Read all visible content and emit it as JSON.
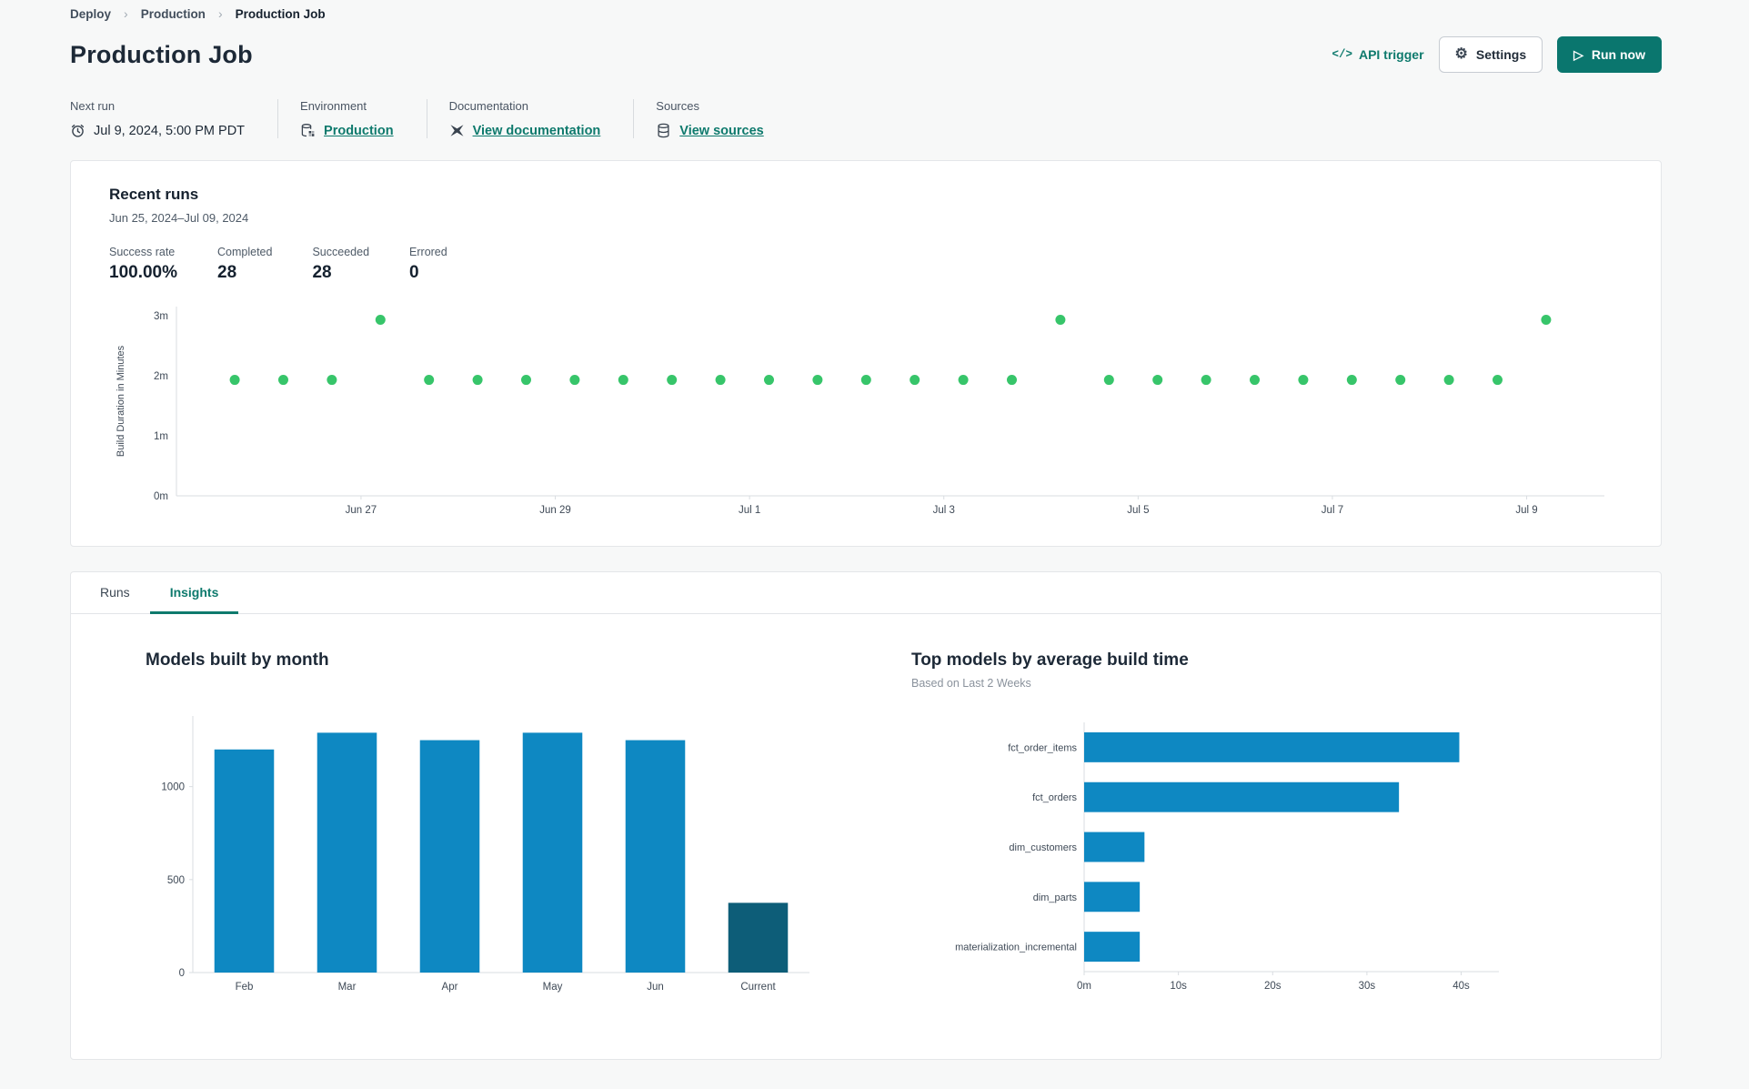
{
  "breadcrumb": {
    "items": [
      "Deploy",
      "Production",
      "Production Job"
    ]
  },
  "header": {
    "title": "Production Job",
    "api_trigger_label": "API trigger",
    "settings_label": "Settings",
    "run_now_label": "Run now"
  },
  "info": {
    "next_run": {
      "label": "Next run",
      "value": "Jul 9, 2024, 5:00 PM PDT"
    },
    "environment": {
      "label": "Environment",
      "value": "Production"
    },
    "documentation": {
      "label": "Documentation",
      "value": "View documentation"
    },
    "sources": {
      "label": "Sources",
      "value": "View sources"
    }
  },
  "recent_runs": {
    "title": "Recent runs",
    "date_range": "Jun 25, 2024–Jul 09, 2024",
    "stats": [
      {
        "label": "Success rate",
        "value": "100.00%"
      },
      {
        "label": "Completed",
        "value": "28"
      },
      {
        "label": "Succeeded",
        "value": "28"
      },
      {
        "label": "Errored",
        "value": "0"
      }
    ]
  },
  "tabs": [
    {
      "label": "Runs",
      "active": false
    },
    {
      "label": "Insights",
      "active": true
    }
  ],
  "colors": {
    "accent": "#0a766e",
    "link": "#0e7a6d",
    "page_bg": "#f7f8f8",
    "card_border": "#e4e6e9",
    "scatter_point": "#37c56a",
    "bar_blue": "#0e88c2",
    "bar_dark": "#0d5d78"
  },
  "chart_data": [
    {
      "id": "recent-runs-scatter",
      "type": "scatter",
      "ylabel": "Build Duration in Minutes",
      "point_color": "#37c56a",
      "x": [
        0,
        1,
        2,
        3,
        4,
        5,
        6,
        7,
        8,
        9,
        10,
        11,
        12,
        13,
        14,
        15,
        16,
        17,
        18,
        19,
        20,
        21,
        22,
        23,
        24,
        25,
        26,
        27
      ],
      "y": [
        1.93,
        1.93,
        1.93,
        2.93,
        1.93,
        1.93,
        1.93,
        1.93,
        1.93,
        1.93,
        1.93,
        1.93,
        1.93,
        1.93,
        1.93,
        1.93,
        1.93,
        2.93,
        1.93,
        1.93,
        1.93,
        1.93,
        1.93,
        1.93,
        1.93,
        1.93,
        1.93,
        2.93
      ],
      "xlim": [
        -1.2,
        28.2
      ],
      "ylim": [
        0,
        3.15
      ],
      "yticks": [
        {
          "v": 0,
          "label": "0m"
        },
        {
          "v": 1,
          "label": "1m"
        },
        {
          "v": 2,
          "label": "2m"
        },
        {
          "v": 3,
          "label": "3m"
        }
      ],
      "xticks": [
        {
          "v": 2.6,
          "label": "Jun 27"
        },
        {
          "v": 6.6,
          "label": "Jun 29"
        },
        {
          "v": 10.6,
          "label": "Jul 1"
        },
        {
          "v": 14.6,
          "label": "Jul 3"
        },
        {
          "v": 18.6,
          "label": "Jul 5"
        },
        {
          "v": 22.6,
          "label": "Jul 7"
        },
        {
          "v": 26.6,
          "label": "Jul 9"
        }
      ],
      "grid": false,
      "legend": "none"
    },
    {
      "id": "models-built-by-month",
      "type": "bar",
      "title": "Models built by month",
      "categories": [
        "Feb",
        "Mar",
        "Apr",
        "May",
        "Jun",
        "Current"
      ],
      "values": [
        1200,
        1290,
        1250,
        1290,
        1250,
        375
      ],
      "bar_color": "#0e88c2",
      "highlight_index": 5,
      "highlight_color": "#0d5d78",
      "yticks": [
        {
          "v": 0,
          "label": "0"
        },
        {
          "v": 500,
          "label": "500"
        },
        {
          "v": 1000,
          "label": "1000"
        }
      ],
      "ylim": [
        0,
        1380
      ],
      "xlabel": "",
      "ylabel": "",
      "grid": false,
      "legend": "none"
    },
    {
      "id": "top-models-by-avg-build-time",
      "type": "hbar",
      "title": "Top models by average build time",
      "subtitle": "Based on Last 2 Weeks",
      "categories": [
        "fct_order_items",
        "fct_orders",
        "dim_customers",
        "dim_parts",
        "materialization_incremental"
      ],
      "values": [
        39.8,
        33.4,
        6.4,
        5.9,
        5.9
      ],
      "unit": "seconds",
      "bar_color": "#0e88c2",
      "xticks": [
        {
          "v": 0,
          "label": "0m"
        },
        {
          "v": 10,
          "label": "10s"
        },
        {
          "v": 20,
          "label": "20s"
        },
        {
          "v": 30,
          "label": "30s"
        },
        {
          "v": 40,
          "label": "40s"
        }
      ],
      "xlim": [
        0,
        44
      ],
      "xlabel": "",
      "ylabel": "",
      "grid": false,
      "legend": "none"
    }
  ]
}
